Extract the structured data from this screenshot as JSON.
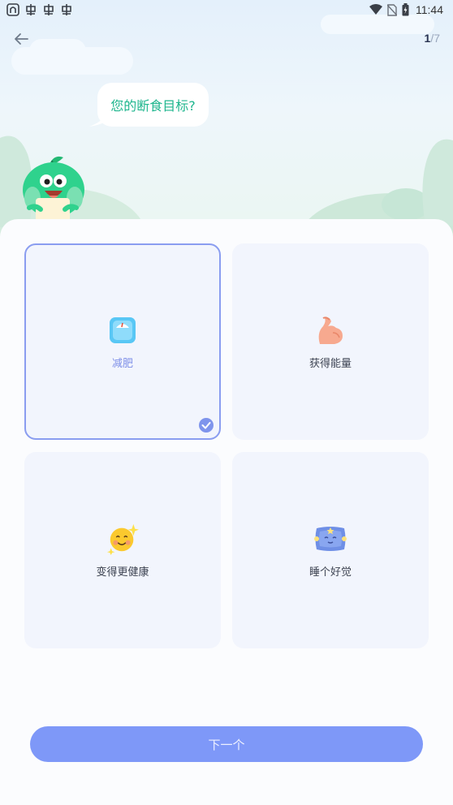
{
  "status_bar": {
    "time": "11:44",
    "left_icons": [
      "app-notification-icon",
      "bug-icon",
      "bug-icon",
      "bug-icon"
    ],
    "right_icons": [
      "wifi-icon",
      "no-sim-icon",
      "battery-charging-icon"
    ]
  },
  "header": {
    "step_current": "1",
    "step_total": "/7"
  },
  "question": "您的断食目标?",
  "options": [
    {
      "label": "减肥",
      "icon": "scale-icon",
      "selected": true
    },
    {
      "label": "获得能量",
      "icon": "flexed-biceps-icon",
      "selected": false
    },
    {
      "label": "变得更健康",
      "icon": "smiling-sun-icon",
      "selected": false
    },
    {
      "label": "睡个好觉",
      "icon": "pillow-icon",
      "selected": false
    }
  ],
  "next_button": "下一个",
  "colors": {
    "accent": "#7e98f8",
    "selected_border": "#8a9df0",
    "question_text": "#1fb68e",
    "card_bg": "#f2f5fd"
  }
}
